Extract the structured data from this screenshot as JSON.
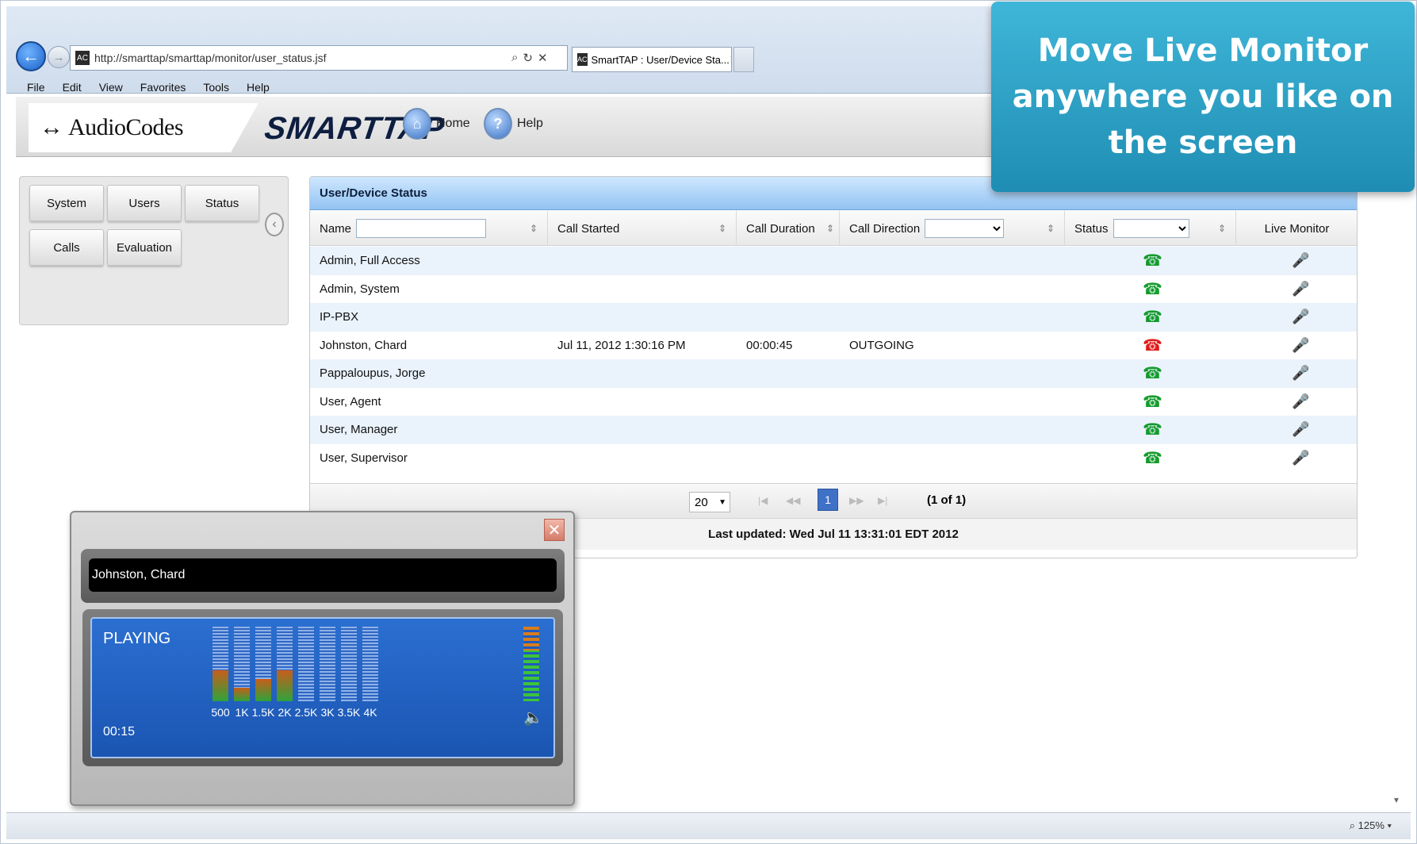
{
  "browser": {
    "url": "http://smarttap/smarttap/monitor/user_status.jsf",
    "tab_title": "SmartTAP : User/Device Sta...",
    "menu": [
      "File",
      "Edit",
      "View",
      "Favorites",
      "Tools",
      "Help"
    ],
    "zoom": "125%"
  },
  "header": {
    "logo": "AudioCodes",
    "product": "SMARTTAP",
    "home_label": "Home",
    "help_label": "Help"
  },
  "left_nav": {
    "buttons": [
      "System",
      "Users",
      "Status",
      "Calls",
      "Evaluation"
    ]
  },
  "panel": {
    "title": "User/Device Status",
    "columns": {
      "name": "Name",
      "call_started": "Call Started",
      "call_duration": "Call Duration",
      "call_direction": "Call Direction",
      "status": "Status",
      "live_monitor": "Live Monitor"
    },
    "rows": [
      {
        "name": "Admin, Full Access",
        "call_started": "",
        "call_duration": "",
        "call_direction": "",
        "status": "idle"
      },
      {
        "name": "Admin, System",
        "call_started": "",
        "call_duration": "",
        "call_direction": "",
        "status": "idle"
      },
      {
        "name": "IP-PBX",
        "call_started": "",
        "call_duration": "",
        "call_direction": "",
        "status": "idle"
      },
      {
        "name": "Johnston, Chard",
        "call_started": "Jul 11, 2012 1:30:16 PM",
        "call_duration": "00:00:45",
        "call_direction": "OUTGOING",
        "status": "busy"
      },
      {
        "name": "Pappaloupus, Jorge",
        "call_started": "",
        "call_duration": "",
        "call_direction": "",
        "status": "idle"
      },
      {
        "name": "User, Agent",
        "call_started": "",
        "call_duration": "",
        "call_direction": "",
        "status": "idle"
      },
      {
        "name": "User, Manager",
        "call_started": "",
        "call_duration": "",
        "call_direction": "",
        "status": "idle"
      },
      {
        "name": "User, Supervisor",
        "call_started": "",
        "call_duration": "",
        "call_direction": "",
        "status": "idle"
      }
    ],
    "pager": {
      "page_size": "20",
      "current_page": "1",
      "info": "(1 of 1)"
    },
    "last_updated": "Last updated: Wed Jul 11 13:31:01 EDT 2012"
  },
  "callout": {
    "text": "Move Live Monitor anywhere you like on the screen"
  },
  "monitor": {
    "name": "Johnston, Chard",
    "state": "PLAYING",
    "time": "00:15",
    "bands": [
      {
        "label": "500",
        "level": 0.42
      },
      {
        "label": "1K",
        "level": 0.18
      },
      {
        "label": "1.5K",
        "level": 0.3
      },
      {
        "label": "2K",
        "level": 0.42
      },
      {
        "label": "2.5K",
        "level": 0
      },
      {
        "label": "3K",
        "level": 0
      },
      {
        "label": "3.5K",
        "level": 0
      },
      {
        "label": "4K",
        "level": 0
      }
    ]
  },
  "icons": {
    "status_idle": "green-phone-icon",
    "status_busy": "red-phone-icon",
    "live_monitor": "microphone-icon"
  }
}
